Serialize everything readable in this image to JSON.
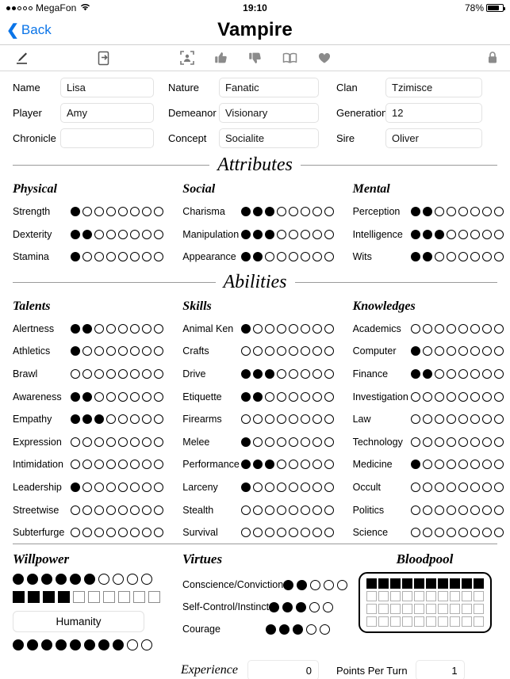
{
  "status_bar": {
    "carrier": "MegaFon",
    "signal_dots": [
      true,
      true,
      false,
      false,
      false
    ],
    "wifi_icon": "wifi-icon",
    "time": "19:10",
    "battery_text": "78%",
    "battery_level": 78
  },
  "nav": {
    "back_label": "Back",
    "title": "Vampire"
  },
  "toolbar": {
    "icons": [
      {
        "name": "pencil-icon",
        "label": "Edit"
      },
      {
        "name": "document-icon",
        "label": "Notes"
      },
      {
        "name": "portrait-icon",
        "label": "Portrait"
      },
      {
        "name": "thumbs-up-icon",
        "label": "Merits"
      },
      {
        "name": "thumbs-down-icon",
        "label": "Flaws"
      },
      {
        "name": "book-icon",
        "label": "Reference"
      },
      {
        "name": "heart-icon",
        "label": "Favorites"
      },
      {
        "name": "lock-icon",
        "label": "Lock"
      }
    ]
  },
  "identity": {
    "column1": [
      {
        "label": "Name",
        "value": "Lisa",
        "placeholder": ""
      },
      {
        "label": "Player",
        "value": "Amy",
        "placeholder": ""
      },
      {
        "label": "Chronicle",
        "value": "",
        "placeholder": ""
      }
    ],
    "column2": [
      {
        "label": "Nature",
        "value": "Fanatic",
        "placeholder": ""
      },
      {
        "label": "Demeanor",
        "value": "Visionary",
        "placeholder": ""
      },
      {
        "label": "Concept",
        "value": "Socialite",
        "placeholder": ""
      }
    ],
    "column3": [
      {
        "label": "Clan",
        "value": "Tzimisce",
        "placeholder": ""
      },
      {
        "label": "Generation",
        "value": "12",
        "placeholder": ""
      },
      {
        "label": "Sire",
        "value": "Oliver",
        "placeholder": ""
      }
    ]
  },
  "attributes": {
    "heading": "Attributes",
    "max": 8,
    "groups": [
      {
        "title": "Physical",
        "stats": [
          {
            "name": "Strength",
            "value": 1
          },
          {
            "name": "Dexterity",
            "value": 2
          },
          {
            "name": "Stamina",
            "value": 1
          }
        ]
      },
      {
        "title": "Social",
        "stats": [
          {
            "name": "Charisma",
            "value": 3
          },
          {
            "name": "Manipulation",
            "value": 3
          },
          {
            "name": "Appearance",
            "value": 2
          }
        ]
      },
      {
        "title": "Mental",
        "stats": [
          {
            "name": "Perception",
            "value": 2
          },
          {
            "name": "Intelligence",
            "value": 3
          },
          {
            "name": "Wits",
            "value": 2
          }
        ]
      }
    ]
  },
  "abilities": {
    "heading": "Abilities",
    "max": 8,
    "groups": [
      {
        "title": "Talents",
        "stats": [
          {
            "name": "Alertness",
            "value": 2
          },
          {
            "name": "Athletics",
            "value": 1
          },
          {
            "name": "Brawl",
            "value": 0
          },
          {
            "name": "Awareness",
            "value": 2
          },
          {
            "name": "Empathy",
            "value": 3
          },
          {
            "name": "Expression",
            "value": 0
          },
          {
            "name": "Intimidation",
            "value": 0
          },
          {
            "name": "Leadership",
            "value": 1
          },
          {
            "name": "Streetwise",
            "value": 0
          },
          {
            "name": "Subterfurge",
            "value": 0
          }
        ]
      },
      {
        "title": "Skills",
        "stats": [
          {
            "name": "Animal Ken",
            "value": 1
          },
          {
            "name": "Crafts",
            "value": 0
          },
          {
            "name": "Drive",
            "value": 3
          },
          {
            "name": "Etiquette",
            "value": 2
          },
          {
            "name": "Firearms",
            "value": 0
          },
          {
            "name": "Melee",
            "value": 1
          },
          {
            "name": "Performance",
            "value": 3
          },
          {
            "name": "Larceny",
            "value": 1
          },
          {
            "name": "Stealth",
            "value": 0
          },
          {
            "name": "Survival",
            "value": 0
          }
        ]
      },
      {
        "title": "Knowledges",
        "stats": [
          {
            "name": "Academics",
            "value": 0
          },
          {
            "name": "Computer",
            "value": 1
          },
          {
            "name": "Finance",
            "value": 2
          },
          {
            "name": "Investigation",
            "value": 0
          },
          {
            "name": "Law",
            "value": 0
          },
          {
            "name": "Technology",
            "value": 0
          },
          {
            "name": "Medicine",
            "value": 1
          },
          {
            "name": "Occult",
            "value": 0
          },
          {
            "name": "Politics",
            "value": 0
          },
          {
            "name": "Science",
            "value": 0
          }
        ]
      }
    ]
  },
  "willpower": {
    "title": "Willpower",
    "dots_max": 10,
    "dots_value": 6,
    "boxes_max": 10,
    "boxes_value": 4,
    "humanity_label": "Humanity",
    "humanity_max": 10,
    "humanity_value": 8
  },
  "virtues": {
    "title": "Virtues",
    "max": 5,
    "stats": [
      {
        "name": "Conscience/Conviction",
        "value": 2
      },
      {
        "name": "Self-Control/Instinct",
        "value": 3
      },
      {
        "name": "Courage",
        "value": 3
      }
    ]
  },
  "bloodpool": {
    "title": "Bloodpool",
    "columns": 10,
    "rows": 4,
    "filled": 10
  },
  "footer": {
    "experience_label": "Experience",
    "experience_value": "0",
    "points_per_turn_label": "Points Per Turn",
    "points_per_turn_value": "1"
  },
  "colors": {
    "accent": "#0a74e8",
    "text": "#000000",
    "icon_gray": "#7a7a7a",
    "rule": "#9a9a9a",
    "field_border": "#e2e2e2"
  }
}
